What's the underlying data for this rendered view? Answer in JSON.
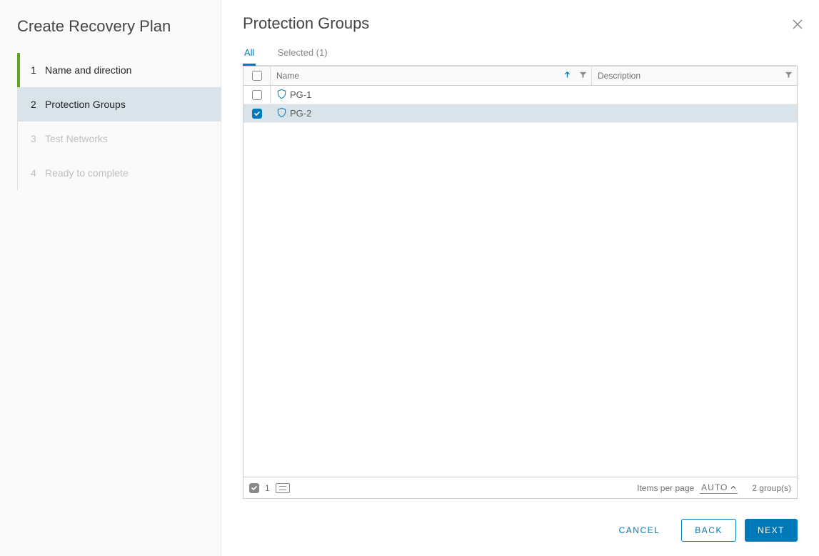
{
  "sidebar": {
    "title": "Create Recovery Plan",
    "steps": [
      {
        "num": "1",
        "label": "Name and direction",
        "state": "done"
      },
      {
        "num": "2",
        "label": "Protection Groups",
        "state": "active"
      },
      {
        "num": "3",
        "label": "Test Networks",
        "state": "disabled"
      },
      {
        "num": "4",
        "label": "Ready to complete",
        "state": "disabled"
      }
    ]
  },
  "panel": {
    "title": "Protection Groups"
  },
  "tabs": {
    "all": "All",
    "selected": "Selected (1)"
  },
  "grid": {
    "headers": {
      "name": "Name",
      "description": "Description"
    },
    "rows": [
      {
        "name": "PG-1",
        "description": "",
        "checked": false
      },
      {
        "name": "PG-2",
        "description": "",
        "checked": true
      }
    ],
    "footer": {
      "selected_count": "1",
      "items_per_page_label": "Items per page",
      "items_per_page_value": "AUTO",
      "total": "2 group(s)"
    }
  },
  "buttons": {
    "cancel": "CANCEL",
    "back": "BACK",
    "next": "NEXT"
  }
}
